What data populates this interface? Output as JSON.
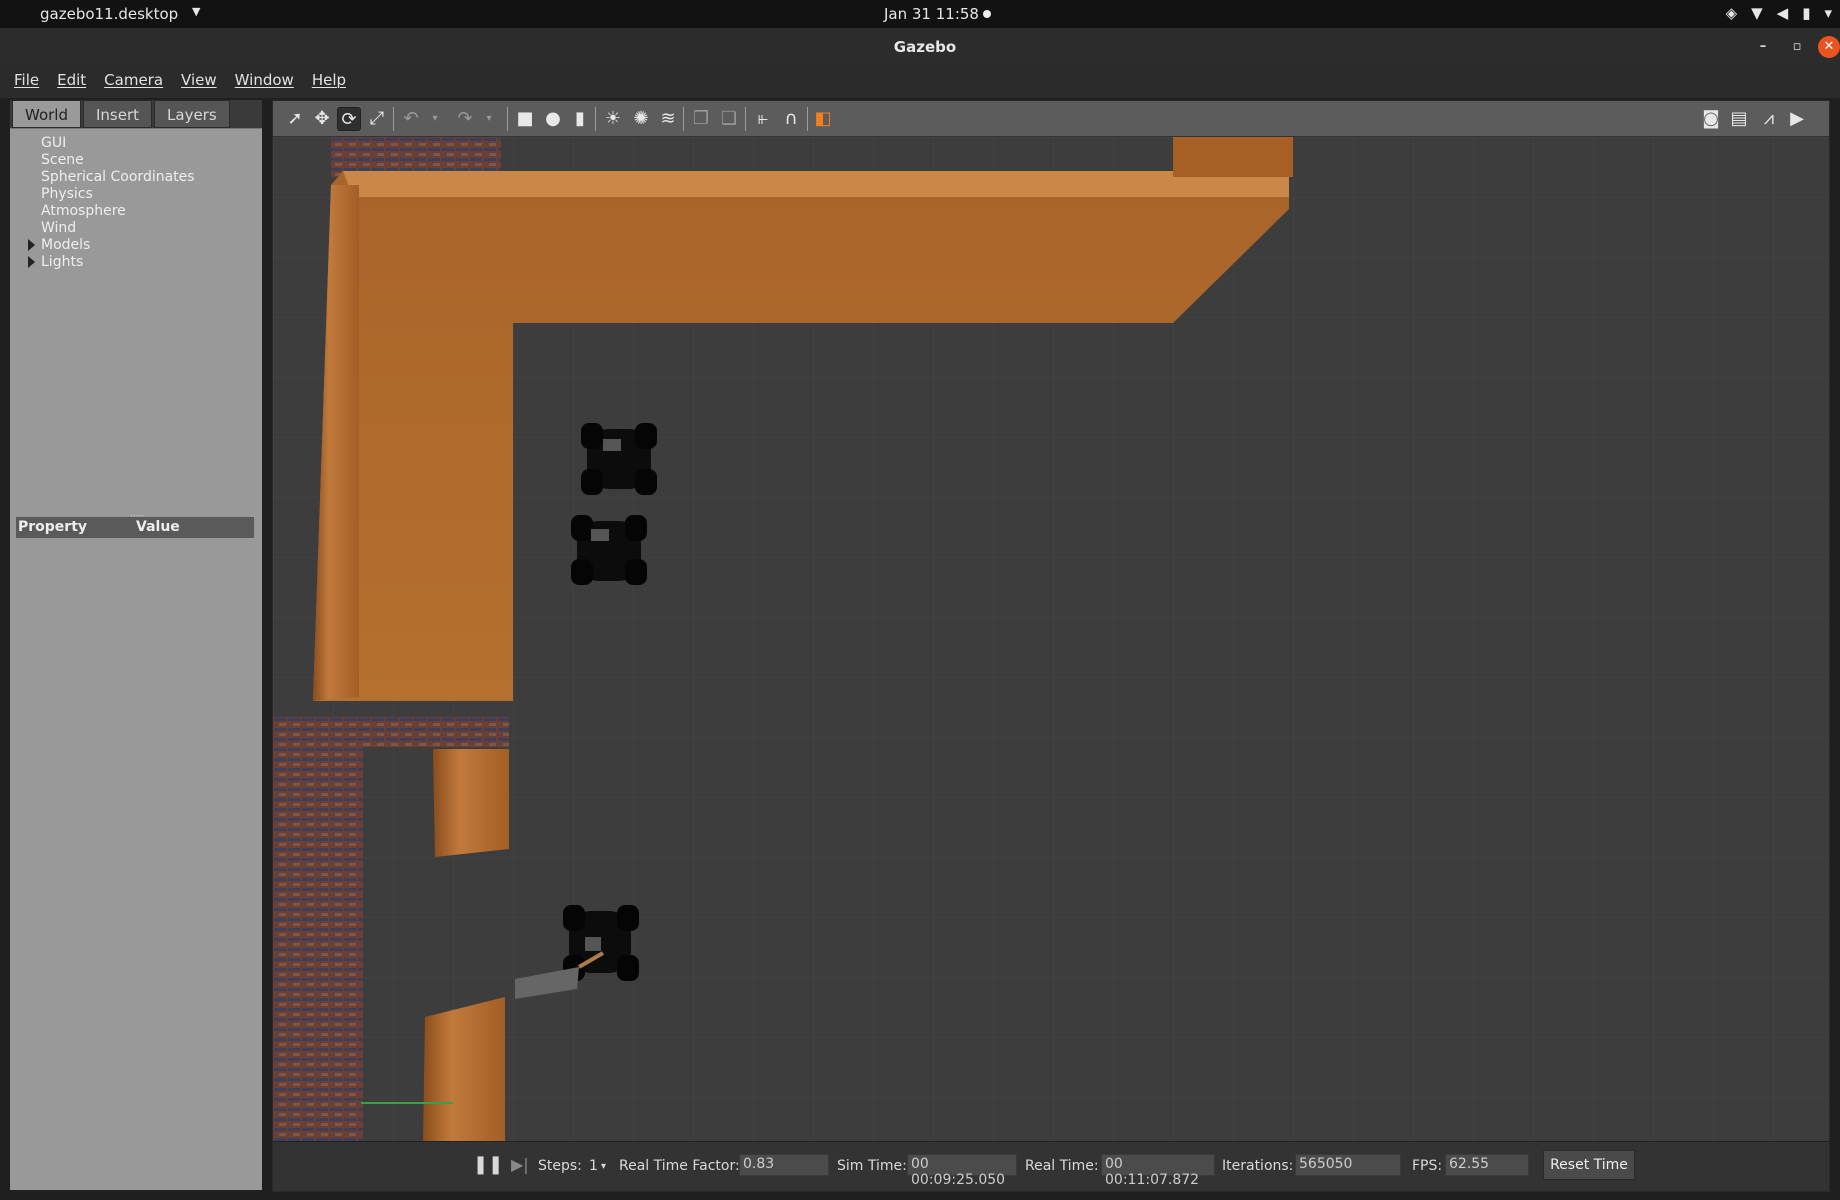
{
  "system_bar": {
    "app_name": "gazebo11.desktop",
    "clock": "Jan 31  11:58"
  },
  "window": {
    "title": "Gazebo",
    "minimize": "–",
    "restore": "▫",
    "close": "✕"
  },
  "menubar": {
    "items": [
      "File",
      "Edit",
      "Camera",
      "View",
      "Window",
      "Help"
    ]
  },
  "left_panel": {
    "tabs": [
      "World",
      "Insert",
      "Layers"
    ],
    "active_tab": "World",
    "tree": [
      "GUI",
      "Scene",
      "Spherical Coordinates",
      "Physics",
      "Atmosphere",
      "Wind",
      "Models",
      "Lights"
    ],
    "property_header": {
      "property": "Property",
      "value": "Value"
    }
  },
  "toolbar": {
    "icons": [
      "select-arrow",
      "translate",
      "rotate",
      "scale",
      "undo",
      "redo",
      "box",
      "sphere",
      "cylinder",
      "point-light",
      "spot-light",
      "directional-light",
      "copy",
      "paste",
      "align",
      "snap",
      "view-angle",
      "screenshot",
      "log",
      "plot",
      "record"
    ]
  },
  "bottom_bar": {
    "steps_label": "Steps:",
    "steps_value": "1",
    "rtf_label": "Real Time Factor:",
    "rtf_value": "0.83",
    "sim_time_label": "Sim Time:",
    "sim_time_value": "00 00:09:25.050",
    "real_time_label": "Real Time:",
    "real_time_value": "00 00:11:07.872",
    "iterations_label": "Iterations:",
    "iterations_value": "565050",
    "fps_label": "FPS:",
    "fps_value": "62.55",
    "reset_label": "Reset Time"
  },
  "colors": {
    "accent_close": "#e95420",
    "wood": "#b86a2c",
    "brick": "#7a4a3a",
    "floor": "#3c3c3c"
  }
}
